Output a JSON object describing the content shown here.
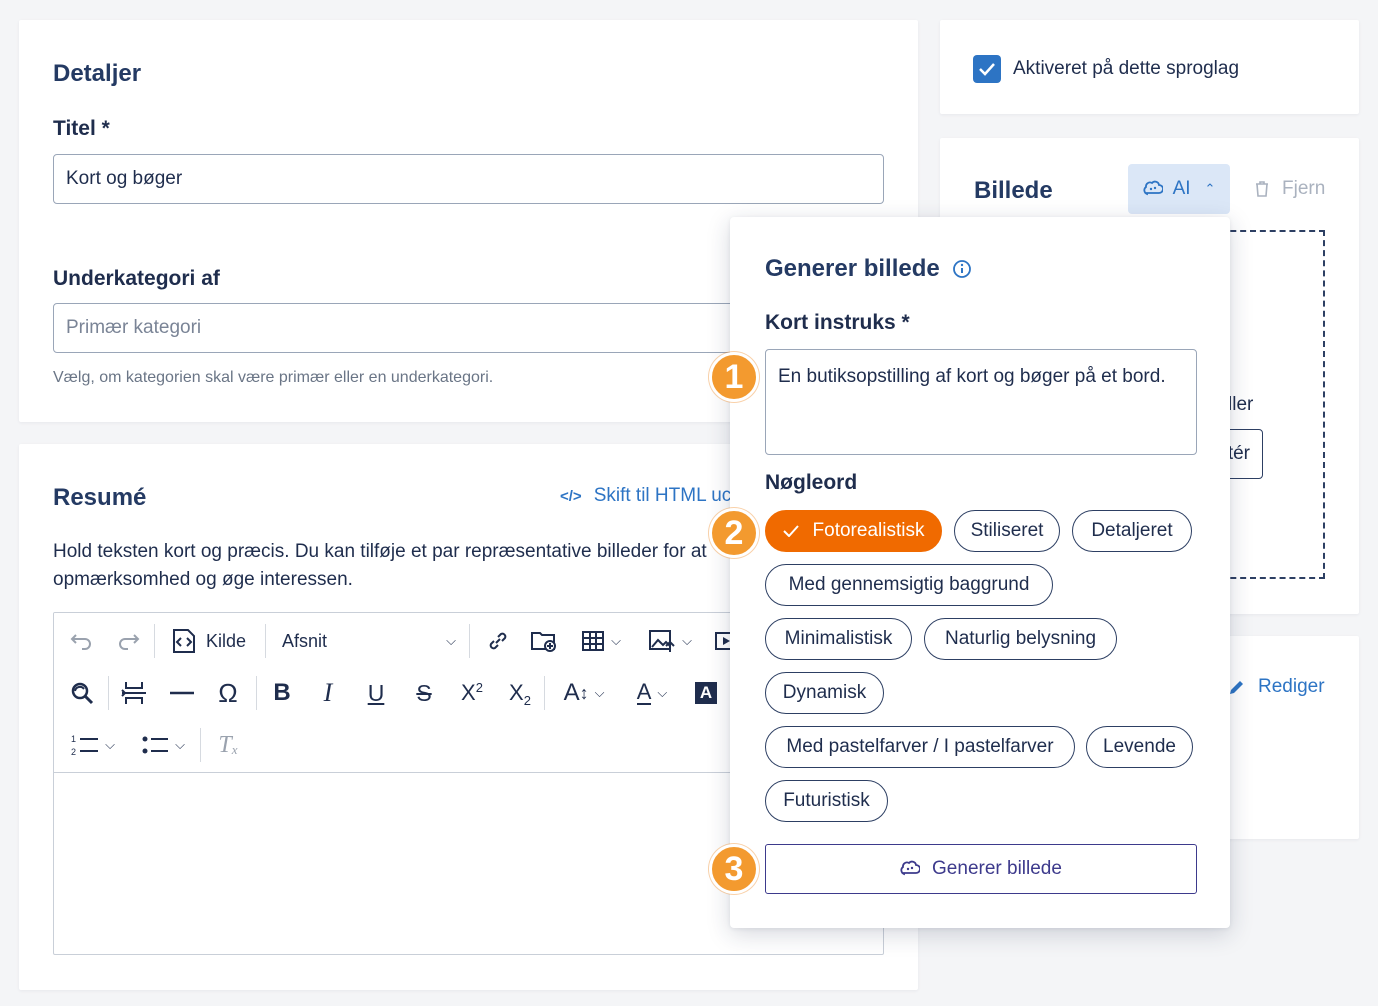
{
  "details": {
    "heading": "Detaljer",
    "title_label": "Titel *",
    "title_value": "Kort og bøger",
    "subcategory_label": "Underkategori af",
    "subcategory_placeholder": "Primær kategori",
    "subcategory_help": "Vælg, om kategorien skal være primær eller en underkategori."
  },
  "summary": {
    "heading": "Resumé",
    "html_toggle": "Skift til HTML uc",
    "description": "Hold teksten kort og præcis. Du kan tilføje et par repræsentative billeder for at",
    "description_line2": "opmærksomhed og øge interessen.",
    "toolbar": {
      "source_label": "Kilde",
      "paragraph_select": "Afsnit"
    }
  },
  "language": {
    "checkbox_label": "Aktiveret på dette sproglag",
    "checked": true
  },
  "image": {
    "heading": "Billede",
    "ai_button": "AI",
    "remove_button": "Fjern",
    "partial_text_1": "ller",
    "partial_button": "tér"
  },
  "edit_card": {
    "edit_link": "Rediger"
  },
  "generate": {
    "heading": "Generer billede",
    "prompt_label": "Kort instruks *",
    "prompt_value": "En butiksopstilling af kort og bøger på et bord.",
    "keywords_label": "Nøgleord",
    "keywords": [
      {
        "label": "Fotorealistisk",
        "selected": true
      },
      {
        "label": "Stiliseret",
        "selected": false
      },
      {
        "label": "Detaljeret",
        "selected": false
      },
      {
        "label": "Med gennemsigtig baggrund",
        "selected": false
      },
      {
        "label": "Minimalistisk",
        "selected": false
      },
      {
        "label": "Naturlig belysning",
        "selected": false
      },
      {
        "label": "Dynamisk",
        "selected": false
      },
      {
        "label": "Med pastelfarver / I pastelfarver",
        "selected": false
      },
      {
        "label": "Levende",
        "selected": false
      },
      {
        "label": "Futuristisk",
        "selected": false
      }
    ],
    "submit_button": "Generer billede"
  },
  "callouts": [
    "1",
    "2",
    "3"
  ],
  "colors": {
    "accent": "#f06a00",
    "badge": "#f39a2f",
    "primary_text": "#243a63",
    "link": "#2d74c4",
    "checkbox": "#2d74c4",
    "ai_button_bg": "#dbe7f7"
  }
}
